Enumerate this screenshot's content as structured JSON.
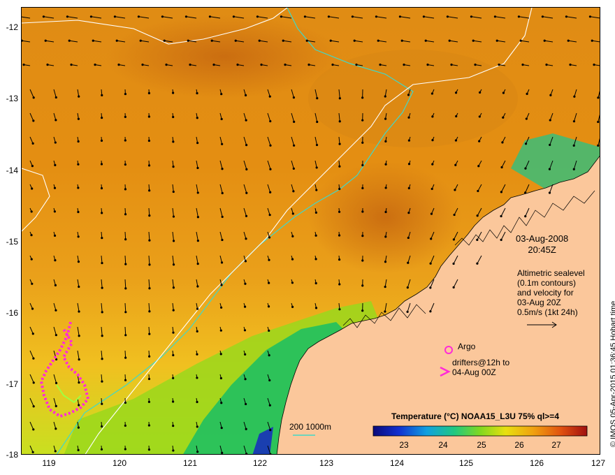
{
  "map": {
    "y_ticks": [
      "-12",
      "-13",
      "-14",
      "-15",
      "-16",
      "-17",
      "-18"
    ],
    "x_ticks": [
      "119",
      "120",
      "121",
      "122",
      "123",
      "124",
      "125",
      "126",
      "127"
    ],
    "date_line1": "03-Aug-2008",
    "date_line2": "20:45Z",
    "altimetry_lines": [
      "Altimetric sealevel",
      "(0.1m contours)",
      "and velocity for",
      "03-Aug 20Z",
      "0.5m/s (1kt 24h)"
    ],
    "argo_label": "Argo",
    "drifter_line1": "drifters@12h to",
    "drifter_line2": "04-Aug 00Z",
    "depth_label": "200  1000m",
    "side_label": "© IMOS 05-Apr-2015 01:36:45 Hobart time",
    "colorbar_title": "Temperature (°C) NOAA15_L3U 75% ql>=4",
    "colorbar_ticks": [
      "23",
      "24",
      "25",
      "26",
      "27"
    ],
    "colors": {
      "land": "#fbc79b",
      "sst_warm": "#e08a10",
      "sst_mid": "#f0b020",
      "sst_cool": "#1cb84a",
      "sst_cold": "#1a2fa0",
      "contour_200": "#40d8c8",
      "contour_1000": "#ffffff",
      "drifter": "#ff2ad8"
    }
  }
}
